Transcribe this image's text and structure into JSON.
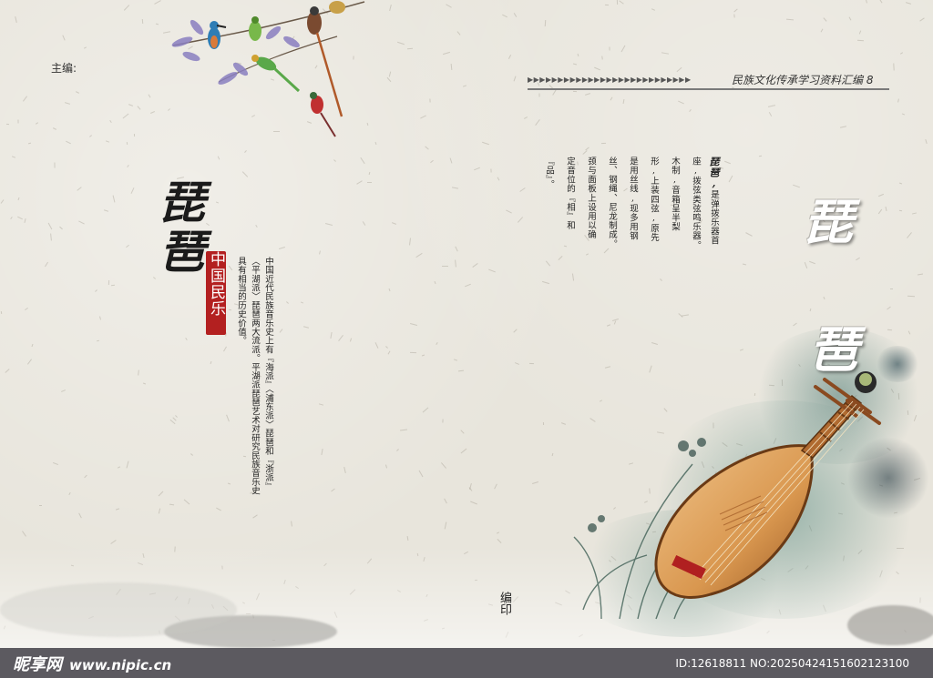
{
  "header": {
    "editor_label": "主编:",
    "series_arrows": "▶▶▶▶▶▶▶▶▶▶▶▶▶▶▶▶▶▶▶▶▶▶▶▶▶▶▶",
    "series_title": "民族文化传承学习资料汇编 8"
  },
  "left_page": {
    "calligraphy_title": "琵琶",
    "seal_text": "中国民乐",
    "intro_columns": [
      "中国近代民族音乐史上有『海派』〈浦东派〉琵琶和『浙派』",
      "〈平湖派〉琵琶两大流派。平湖派琵琶艺术对研究民族音乐史",
      "具有相当的历史价值。"
    ]
  },
  "right_page": {
    "description_head": "琵琶,",
    "description_columns": [
      "是弹拨乐器首",
      "座,拨弦类弦鸣乐器。",
      "木制,音箱呈半梨",
      "形,上装四弦,原先",
      "是用丝线,现多用钢",
      "丝、钢绳、尼龙制成。",
      "颈与面板上设用以确",
      "定音位的『相』和",
      "『品』。"
    ],
    "big_char_1": "琵",
    "big_char_2": "琶",
    "bottom_label": "编印"
  },
  "footer": {
    "logo_text": "昵享网",
    "logo_url": "www.nipic.cn",
    "id_text": "ID:12618811 NO:20250424151602123100"
  },
  "colors": {
    "paper": "#e8e5dc",
    "seal_red": "#b32020",
    "footer_bar": "#5c5a60",
    "ink_green": "#4d7a73"
  }
}
